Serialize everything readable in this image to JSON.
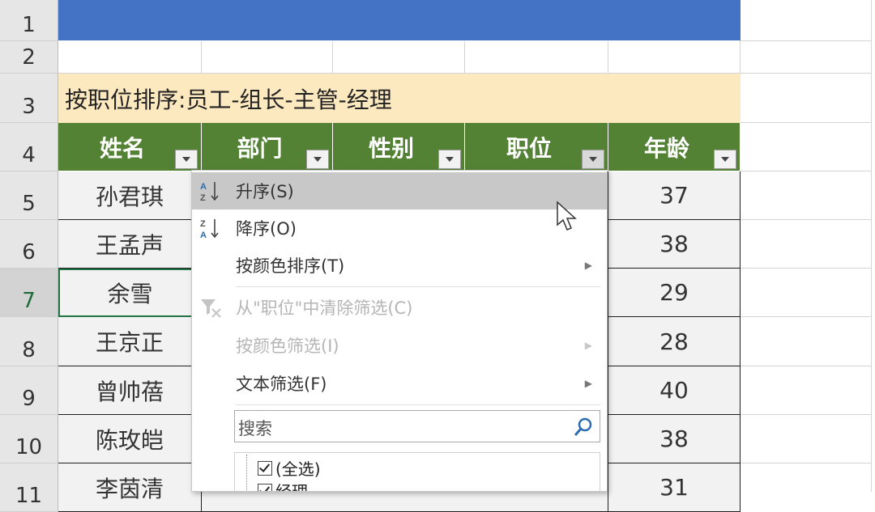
{
  "row_numbers": [
    "1",
    "2",
    "3",
    "4",
    "5",
    "6",
    "7",
    "8",
    "9",
    "10",
    "11"
  ],
  "note": "按职位排序:员工-组长-主管-经理",
  "headers": [
    "姓名",
    "部门",
    "性别",
    "职位",
    "年龄"
  ],
  "names": [
    "孙君琪",
    "王孟声",
    "余雪",
    "王京正",
    "曾帅蓓",
    "陈玫皑",
    "李茵清"
  ],
  "ages": [
    "37",
    "38",
    "29",
    "28",
    "40",
    "38",
    "31"
  ],
  "menu": {
    "sort_asc": "升序(S)",
    "sort_desc": "降序(O)",
    "sort_by_color": "按颜色排序(T)",
    "clear_filter": "从\"职位\"中清除筛选(C)",
    "filter_by_color": "按颜色筛选(I)",
    "text_filter": "文本筛选(F)",
    "search_placeholder": "搜索",
    "select_all": "(全选)",
    "item_manager": "经理"
  },
  "icons": {
    "sort_asc": "sort-az-icon",
    "sort_desc": "sort-za-icon",
    "clear_filter": "clear-filter-icon",
    "search": "search-icon",
    "filter_dropdown": "dropdown-arrow-icon"
  },
  "colors": {
    "title_band": "#4472c4",
    "note_band": "#fde9c0",
    "header_band": "#548235",
    "data_cell": "#f2f2f2",
    "menu_hover": "#c8c8c8"
  }
}
